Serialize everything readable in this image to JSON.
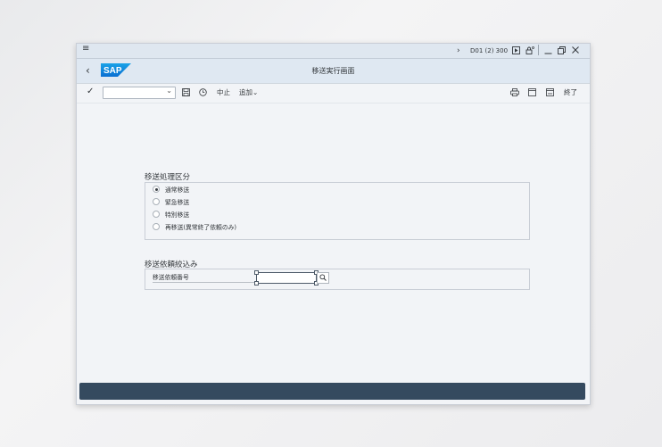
{
  "window": {
    "system_info": "D01 (2) 300",
    "icons": {
      "menu": "hamburger-menu-icon",
      "expand": "chevron-right-icon",
      "session": "play-box-icon",
      "customize": "lock-settings-icon",
      "minimize": "minimize-icon",
      "restore": "restore-icon",
      "close": "close-icon"
    }
  },
  "shell": {
    "back_icon": "back-arrow-icon",
    "logo": "SAP",
    "title": "移送実行画面",
    "brand_color": "#0a6ed1"
  },
  "toolbar": {
    "command_field_value": "",
    "cancel_label": "中止",
    "more_label": "追加",
    "exit_label": "終了"
  },
  "main": {
    "processing_group": {
      "title": "移送処理区分",
      "options": [
        {
          "label": "通常移送",
          "selected": true
        },
        {
          "label": "緊急移送",
          "selected": false
        },
        {
          "label": "特別移送",
          "selected": false
        },
        {
          "label": "再移送(異常終了依頼のみ)",
          "selected": false
        }
      ]
    },
    "filter_group": {
      "title": "移送依頼絞込み",
      "field_label": "移送依頼番号",
      "field_value": ""
    }
  },
  "colors": {
    "status_bar": "#354a5f",
    "background": "#f2f4f7"
  }
}
